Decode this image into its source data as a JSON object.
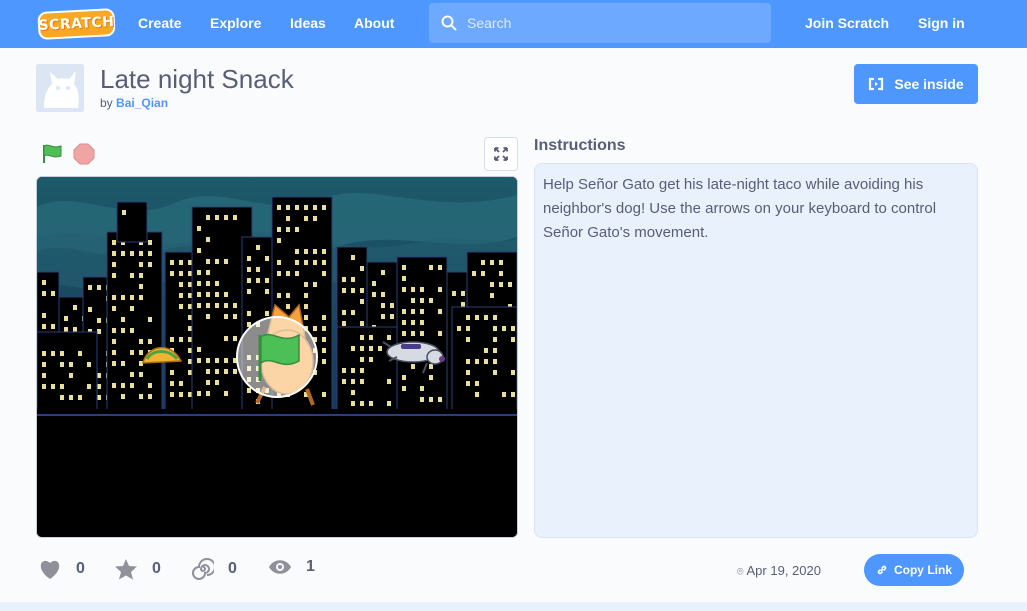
{
  "nav": {
    "logo": "SCRATCH",
    "links": [
      "Create",
      "Explore",
      "Ideas",
      "About"
    ],
    "search_placeholder": "Search",
    "join": "Join Scratch",
    "signin": "Sign in"
  },
  "project": {
    "title": "Late night Snack",
    "by_prefix": "by",
    "author": "Bai_Qian",
    "see_inside": "See inside",
    "instructions_label": "Instructions",
    "instructions": "Help Señor Gato get his late-night taco while avoiding his neighbor's dog! Use the arrows on your keyboard to control Señor Gato's movement."
  },
  "stats": {
    "loves": "0",
    "favorites": "0",
    "remixes": "0",
    "views": "1"
  },
  "footer": {
    "date": "Apr 19, 2020",
    "copy_link": "Copy Link"
  },
  "colors": {
    "brand_blue": "#4d97ff",
    "logo_orange": "#f9a825",
    "flag_green": "#4cbf56",
    "stop_red": "#ec5959"
  }
}
